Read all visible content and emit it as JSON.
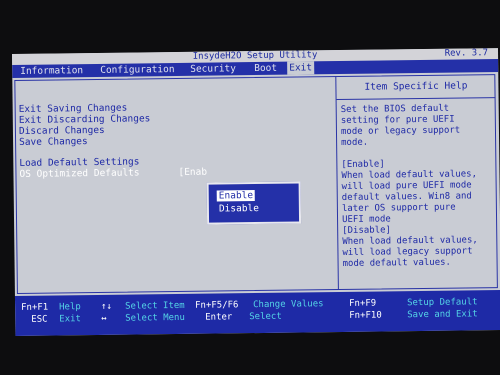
{
  "header": {
    "title": "InsydeH2O Setup Utility",
    "revision": "Rev. 3.7"
  },
  "menu": [
    "Information",
    "Configuration",
    "Security",
    "Boot",
    "Exit"
  ],
  "options": [
    "Exit Saving Changes",
    "Exit Discarding Changes",
    "Discard Changes",
    "Save Changes",
    "Load Default Settings",
    "OS Optimized Defaults"
  ],
  "os_value": "[Enab",
  "popup": {
    "options": [
      "Enable",
      "Disable"
    ],
    "selected": "Enable"
  },
  "help": {
    "title": "Item Specific Help",
    "lines": [
      "Set the BIOS default",
      "setting for pure UEFI",
      "mode or legacy support",
      "mode.",
      "",
      "[Enable]",
      "When load default values,",
      "  will load pure UEFI mode",
      "  default values. Win8 and",
      "  later OS support pure",
      "UEFI mode",
      "[Disable]",
      "When load default values,",
      "  will load legacy support",
      "  mode default values."
    ]
  },
  "footer": {
    "keys": [
      "Fn+F1",
      "ESC",
      "↑↓",
      "↔",
      "Fn+F5/F6",
      "Enter",
      "Fn+F9",
      "Fn+F10"
    ],
    "descs": [
      "Help",
      "Exit",
      "Select Item",
      "Select Menu",
      "Change Values",
      "Select",
      "Setup Default",
      "Save and Exit"
    ]
  },
  "colors": {
    "accent": "#2430a8",
    "background": "#c9ccd4",
    "footer_desc": "#54d3e6"
  }
}
